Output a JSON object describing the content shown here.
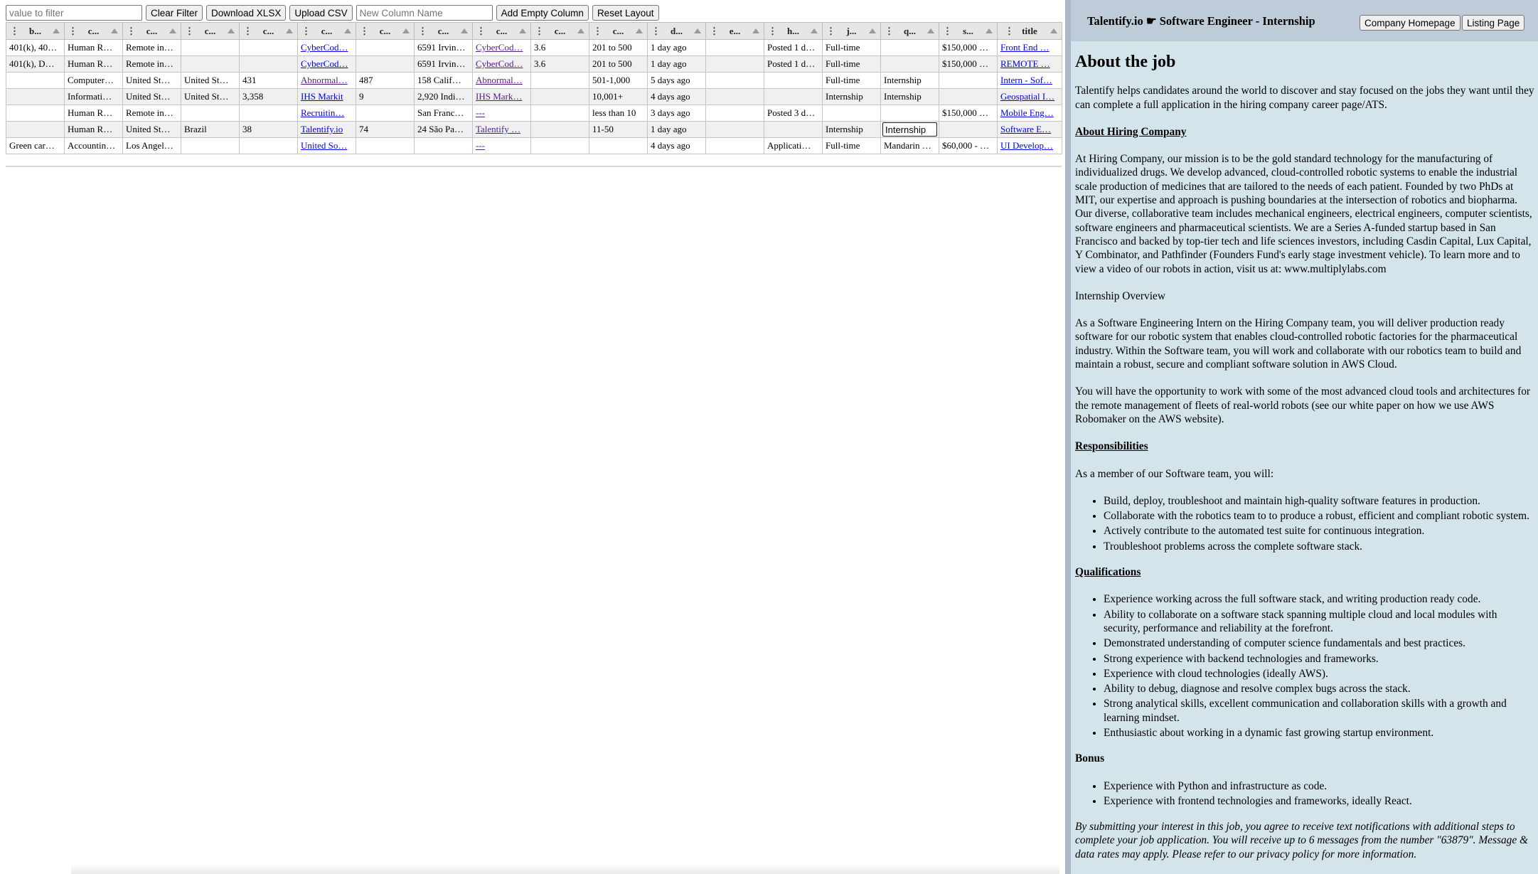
{
  "toolbar": {
    "filter_placeholder": "value to filter",
    "clear_filter": "Clear Filter",
    "download_xlsx": "Download XLSX",
    "upload_csv": "Upload CSV",
    "new_column_placeholder": "New Column Name",
    "add_empty_column": "Add Empty Column",
    "reset_layout": "Reset Layout"
  },
  "grid": {
    "headers": [
      "b...",
      "c...",
      "c...",
      "c...",
      "c...",
      "c...",
      "c...",
      "c...",
      "c...",
      "c...",
      "c...",
      "d...",
      "e...",
      "h...",
      "j...",
      "q...",
      "s...",
      "title"
    ],
    "rows": [
      [
        "401(k), 40…",
        "Human R…",
        "Remote in…",
        "",
        "",
        "CyberCod…",
        "",
        "6591 Irvin…",
        "CyberCod…",
        "3.6",
        "201 to 500",
        "1 day ago",
        "",
        "Posted 1 d…",
        "Full-time",
        "",
        "$150,000 …",
        "Front End …"
      ],
      [
        "401(k), D…",
        "Human R…",
        "Remote in…",
        "",
        "",
        "CyberCod…",
        "",
        "6591 Irvin…",
        "CyberCod…",
        "3.6",
        "201 to 500",
        "1 day ago",
        "",
        "Posted 1 d…",
        "Full-time",
        "",
        "$150,000 …",
        "REMOTE …"
      ],
      [
        "",
        "Computer…",
        "United St…",
        "United St…",
        "431",
        "Abnormal…",
        "487",
        "158 Calif…",
        "Abnormal…",
        "",
        "501-1,000",
        "5 days ago",
        "",
        "",
        "Full-time",
        "Internship",
        "",
        "Intern - Sof…"
      ],
      [
        "",
        "Informati…",
        "United St…",
        "United St…",
        "3,358",
        "IHS Markit",
        "9",
        "2,920 Indi…",
        "IHS Mark…",
        "",
        "10,001+",
        "4 days ago",
        "",
        "",
        "Internship",
        "Internship",
        "",
        "Geospatial I…"
      ],
      [
        "",
        "Human R…",
        "Remote in…",
        "",
        "",
        "Recruitin…",
        "",
        "San Franc…",
        "---",
        "",
        "less than 10",
        "3 days ago",
        "",
        "Posted 3 d…",
        "",
        "",
        "$150,000 …",
        "Mobile Eng…"
      ],
      [
        "",
        "Human R…",
        "United St…",
        "Brazil",
        "38",
        "Talentify.io",
        "74",
        "24 São Pa…",
        "Talentify …",
        "",
        "11-50",
        "1 day ago",
        "",
        "",
        "Internship",
        "Internship",
        "",
        "Software E…"
      ],
      [
        "Green car…",
        "Accountin…",
        "Los Angel…",
        "",
        "",
        "United So…",
        "",
        "",
        "---",
        "",
        "",
        "4 days ago",
        "",
        "Applicati…",
        "Full-time",
        "Mandarin …",
        "$60,000 - …",
        "UI Develop…"
      ]
    ]
  },
  "detail": {
    "job_title": "Talentify.io ☛ Software Engineer - Internship",
    "company_homepage": "Company Homepage",
    "listing_page": "Listing Page",
    "about_heading": "About the job",
    "intro": "Talentify helps candidates around the world to discover and stay focused on the jobs they want until they can complete a full application in the hiring company career page/ATS.",
    "about_company_heading": "About Hiring Company",
    "about_company_text": "At Hiring Company, our mission is to be the gold standard technology for the manufacturing of individualized drugs. We develop advanced, cloud-controlled robotic systems to enable the industrial scale production of medicines that are tailored to the needs of each patient. Founded by two PhDs at MIT, our expertise and approach is pushing boundaries at the intersection of robotics and biopharma. Our diverse, collaborative team includes mechanical engineers, electrical engineers, computer scientists, software engineers and pharmaceutical scientists. We are a Series A-funded startup based in San Francisco and backed by top-tier tech and life sciences investors, including Casdin Capital, Lux Capital, Y Combinator, and Pathfinder (Founders Fund's early stage investment vehicle). To learn more and to view a video of our robots in action, visit us at: www.multiplylabs.com",
    "overview_heading": "Internship Overview",
    "overview_text": "As a Software Engineering Intern on the Hiring Company team, you will deliver production ready software for our robotic system that enables cloud-controlled robotic factories for the pharmaceutical industry. Within the Software team, you will work and collaborate with our robotics team to build and maintain a robust, secure and compliant software solution in AWS Cloud.",
    "opportunity_text": "You will have the opportunity to work with some of the most advanced cloud tools and architectures for the remote management of fleets of real-world robots (see our white paper on how we use AWS Robomaker on the AWS website).",
    "responsibilities_heading": "Responsibilities",
    "responsibilities_intro": "As a member of our Software team, you will:",
    "responsibilities": [
      "Build, deploy, troubleshoot and maintain high-quality software features in production.",
      "Collaborate with the robotics team to to produce a robust, efficient and compliant robotic system.",
      "Actively contribute to the automated test suite for continuous integration.",
      "Troubleshoot problems across the complete software stack."
    ],
    "qualifications_heading": "Qualifications",
    "qualifications": [
      "Experience working across the full software stack, and writing production ready code.",
      "Ability to collaborate on a software stack spanning multiple cloud and local modules with security, performance and reliability at the forefront.",
      "Demonstrated understanding of computer science fundamentals and best practices.",
      "Strong experience with backend technologies and frameworks.",
      "Experience with cloud technologies (ideally AWS).",
      "Ability to debug, diagnose and resolve complex bugs across the stack.",
      "Strong analytical skills, excellent communication and collaboration skills with a growth and learning mindset.",
      "Enthusiastic about working in a dynamic fast growing startup environment."
    ],
    "bonus_heading": "Bonus",
    "bonus": [
      "Experience with Python and infrastructure as code.",
      "Experience with frontend technologies and frameworks, ideally React."
    ],
    "disclaimer": "By submitting your interest in this job, you agree to receive text notifications with additional steps to complete your job application. You will receive up to 6 messages from the number \"63879\". Message & data rates may apply. Please refer to our privacy policy for more information."
  }
}
